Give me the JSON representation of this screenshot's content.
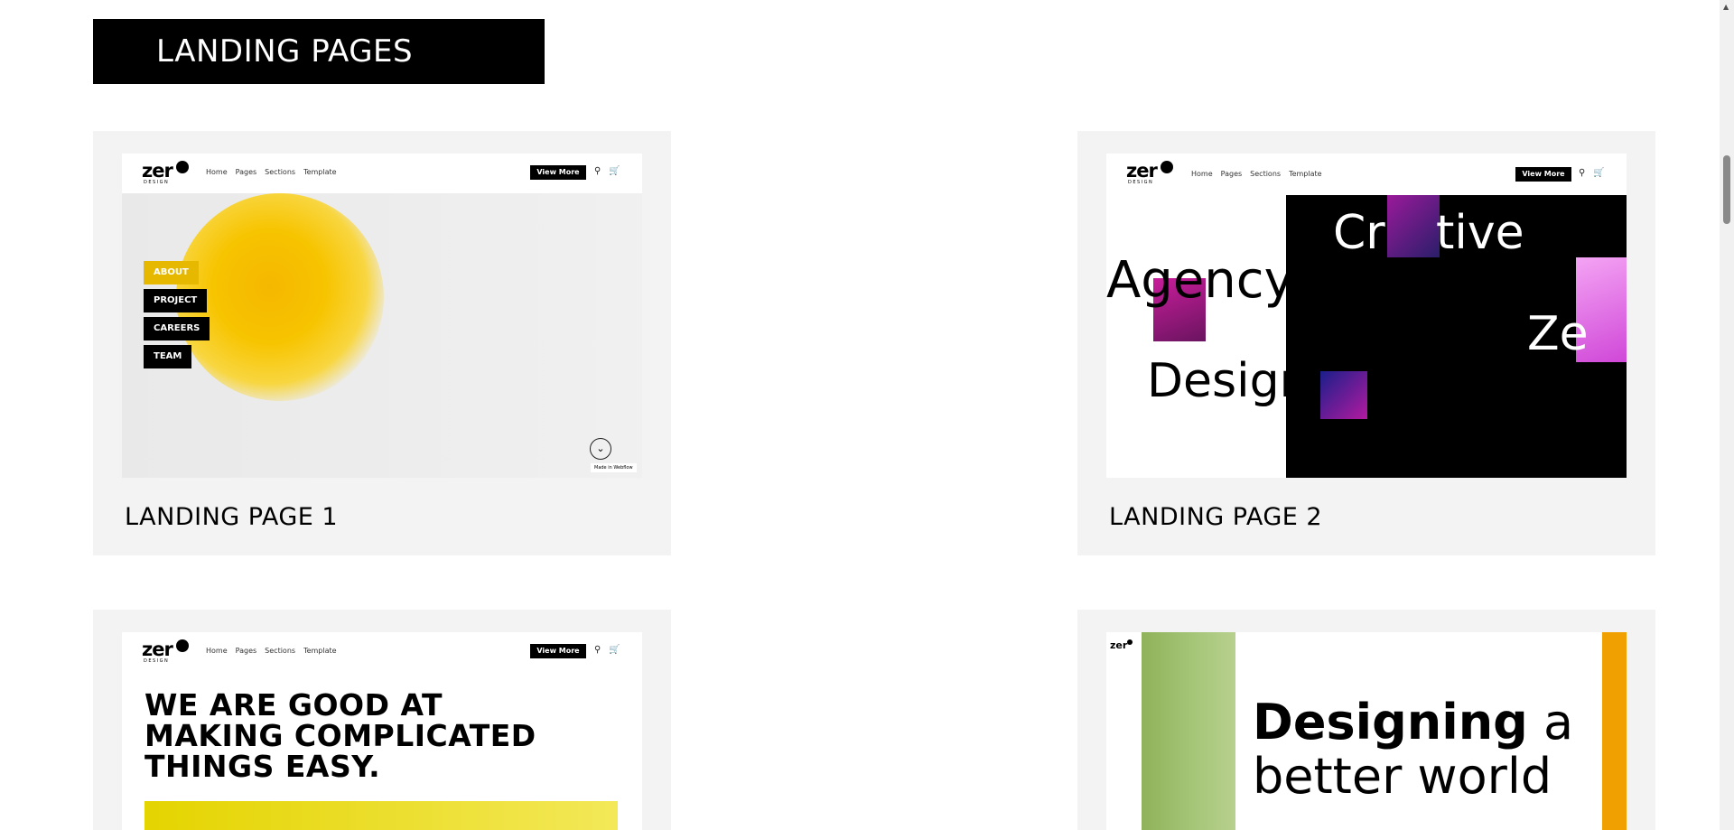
{
  "section": {
    "title": "LANDING PAGES"
  },
  "common_nav": {
    "logo_word": "zer",
    "logo_sub": "DESIGN",
    "home": "Home",
    "pages": "Pages",
    "sections": "Sections",
    "template": "Template",
    "view_more": "View More"
  },
  "cards": [
    {
      "title": "LANDING PAGE 1",
      "buttons": [
        "ABOUT",
        "PROJECT",
        "CAREERS",
        "TEAM"
      ],
      "badge": "Made in Webflow"
    },
    {
      "title": "LANDING PAGE 2",
      "words": [
        "Cr",
        "tive",
        "Agency",
        "Ze",
        "Design"
      ]
    },
    {
      "title": "",
      "headline_lines": [
        "WE ARE GOOD AT",
        "MAKING COMPLICATED",
        "THINGS EASY."
      ]
    },
    {
      "title": "",
      "headline_bold": "Designing",
      "headline_rest": "a",
      "headline_line2": "better world"
    }
  ],
  "colors": {
    "card_bg": "#f3f3f3",
    "header_bg": "#000000",
    "accent_yellow": "#f7c400",
    "accent_orange": "#f0a000",
    "accent_green": "#9fbe6e"
  }
}
